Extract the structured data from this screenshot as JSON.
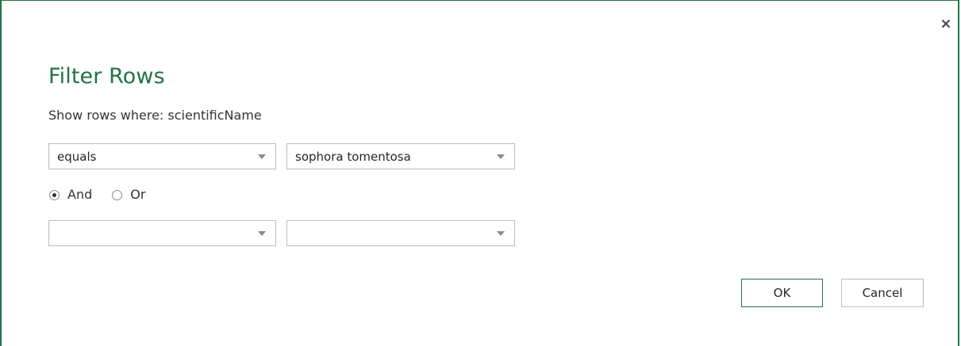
{
  "dialog": {
    "title": "Filter Rows",
    "subtitle": "Show rows where: scientificName",
    "accent_color": "#217346",
    "close_icon": "close-icon"
  },
  "condition1": {
    "operator": "equals",
    "value": "sophora tomentosa"
  },
  "logic": {
    "and_label": "And",
    "or_label": "Or",
    "selected": "And"
  },
  "condition2": {
    "operator": "",
    "value": ""
  },
  "buttons": {
    "ok_label": "OK",
    "cancel_label": "Cancel"
  }
}
